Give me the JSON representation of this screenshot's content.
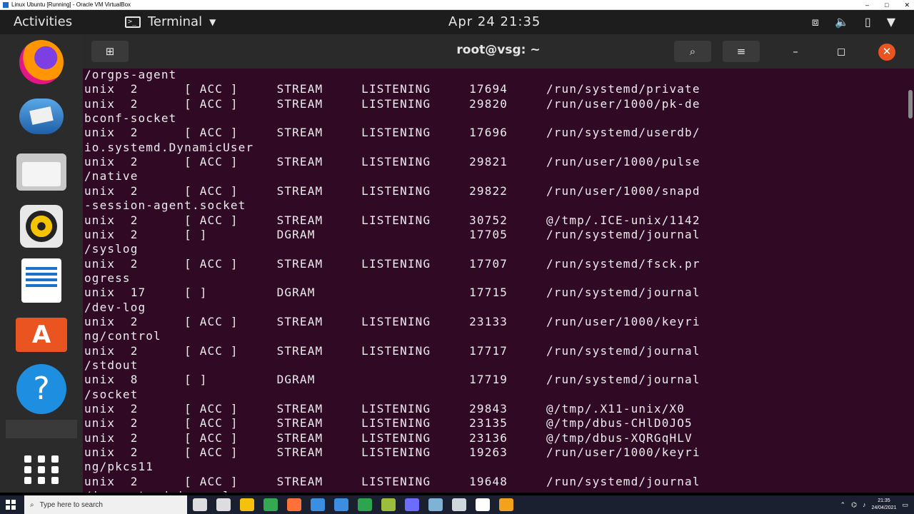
{
  "host": {
    "title": "Linux Ubuntu [Running] - Oracle VM VirtualBox",
    "controls": [
      "–",
      "□",
      "✕"
    ]
  },
  "topbar": {
    "activities": "Activities",
    "app_menu_label": "Terminal",
    "clock": "Apr 24  21:35",
    "tray_icons": [
      "network-icon",
      "volume-icon",
      "battery-icon",
      "system-menu-icon"
    ]
  },
  "dock": {
    "apps": [
      "firefox-icon",
      "thunderbird-icon",
      "files-icon",
      "rhythmbox-icon",
      "writer-icon",
      "software-icon",
      "help-icon",
      "show-apps-icon"
    ],
    "help_glyph": "?",
    "store_glyph": "A"
  },
  "terminal": {
    "title": "root@vsg: ~",
    "new_tab_glyph": "⊞",
    "search_glyph": "⌕",
    "menu_glyph": "≡",
    "minimize_glyph": "–",
    "maximize_glyph": "◻",
    "close_glyph": "✕",
    "lines": [
      "/orgps-agent",
      "unix  2      [ ACC ]     STREAM     LISTENING     17694     /run/systemd/private",
      "unix  2      [ ACC ]     STREAM     LISTENING     29820     /run/user/1000/pk-de",
      "bconf-socket",
      "unix  2      [ ACC ]     STREAM     LISTENING     17696     /run/systemd/userdb/",
      "io.systemd.DynamicUser",
      "unix  2      [ ACC ]     STREAM     LISTENING     29821     /run/user/1000/pulse",
      "/native",
      "unix  2      [ ACC ]     STREAM     LISTENING     29822     /run/user/1000/snapd",
      "-session-agent.socket",
      "unix  2      [ ACC ]     STREAM     LISTENING     30752     @/tmp/.ICE-unix/1142",
      "unix  2      [ ]         DGRAM                    17705     /run/systemd/journal",
      "/syslog",
      "unix  2      [ ACC ]     STREAM     LISTENING     17707     /run/systemd/fsck.pr",
      "ogress",
      "unix  17     [ ]         DGRAM                    17715     /run/systemd/journal",
      "/dev-log",
      "unix  2      [ ACC ]     STREAM     LISTENING     23133     /run/user/1000/keyri",
      "ng/control",
      "unix  2      [ ACC ]     STREAM     LISTENING     17717     /run/systemd/journal",
      "/stdout",
      "unix  8      [ ]         DGRAM                    17719     /run/systemd/journal",
      "/socket",
      "unix  2      [ ACC ]     STREAM     LISTENING     29843     @/tmp/.X11-unix/X0",
      "unix  2      [ ACC ]     STREAM     LISTENING     23135     @/tmp/dbus-CHlD0JO5",
      "unix  2      [ ACC ]     STREAM     LISTENING     23136     @/tmp/dbus-XQRGqHLV",
      "unix  2      [ ACC ]     STREAM     LISTENING     19263     /run/user/1000/keyri",
      "ng/pkcs11",
      "unix  2      [ ACC ]     STREAM     LISTENING     19648     /run/systemd/journal",
      "/io.systemd.journal"
    ]
  },
  "taskbar": {
    "search_placeholder": "Type here to search",
    "time": "21:35",
    "date": "24/04/2021",
    "app_colors": [
      "#ffffff",
      "#ffffff",
      "#f4c20d",
      "#34a853",
      "#ff7139",
      "#3c8ee0",
      "#3c8ee0",
      "#2ea44f",
      "#9bbf3d",
      "#6c6cff",
      "#7fb3d5",
      "#cfd8dc",
      "#ffffff",
      "#f3a21b"
    ]
  }
}
